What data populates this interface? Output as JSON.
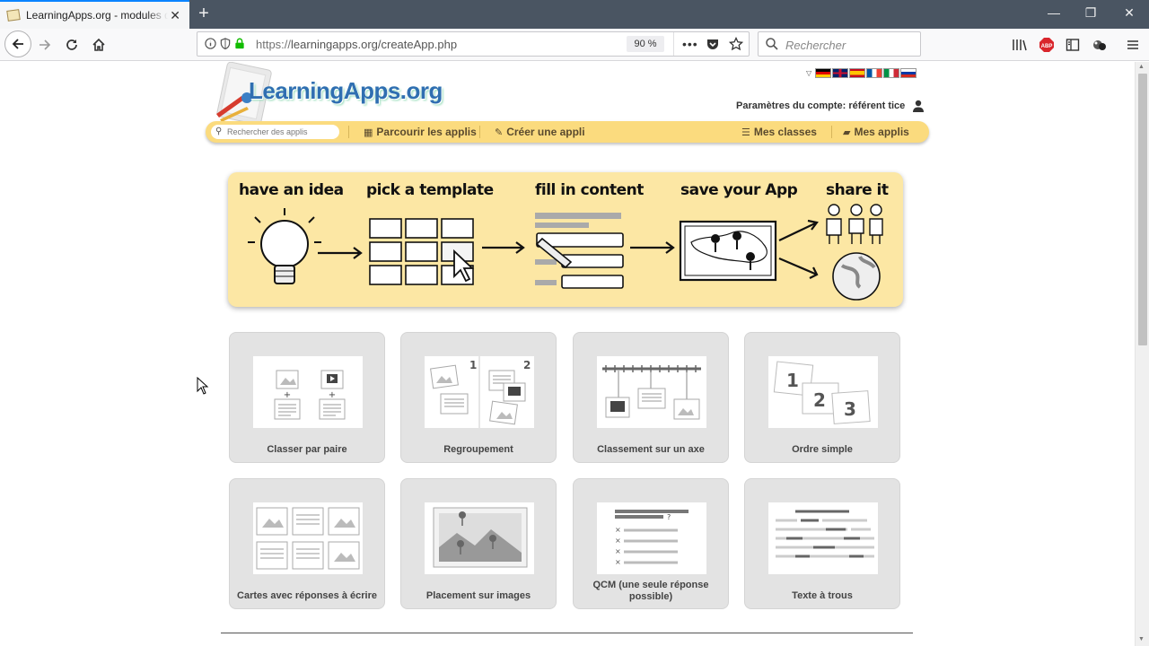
{
  "browser": {
    "tab_title": "LearningApps.org - modules d",
    "url_prefix": "https://",
    "url_main": "learningapps.org/createApp.php",
    "zoom": "90 %",
    "search_placeholder": "Rechercher",
    "window_controls": [
      "—",
      "❐",
      "✕"
    ],
    "tab_close": "✕",
    "new_tab": "+"
  },
  "site": {
    "logo": "LearningApps.org",
    "account_label": "Paramètres du compte: référent tice",
    "languages": [
      "de",
      "en",
      "es",
      "fr",
      "it",
      "ru"
    ],
    "nav": {
      "search_placeholder": "Rechercher des applis",
      "browse": "Parcourir les applis",
      "create": "Créer une appli",
      "classes": "Mes classes",
      "apps": "Mes applis"
    }
  },
  "banner": {
    "steps": [
      "have an idea",
      "pick a template",
      "fill in content",
      "save your App",
      "share it"
    ]
  },
  "templates": [
    {
      "label": "Classer par paire",
      "icon": "pair-matching-icon"
    },
    {
      "label": "Regroupement",
      "icon": "grouping-icon"
    },
    {
      "label": "Classement sur un axe",
      "icon": "timeline-icon"
    },
    {
      "label": "Ordre simple",
      "icon": "simple-order-icon"
    },
    {
      "label": "Cartes avec réponses à écrire",
      "icon": "written-answer-cards-icon"
    },
    {
      "label": "Placement sur images",
      "icon": "image-placement-icon"
    },
    {
      "label": "QCM (une seule réponse possible)",
      "icon": "single-choice-quiz-icon"
    },
    {
      "label": "Texte à trous",
      "icon": "fill-in-blanks-icon"
    }
  ],
  "colors": {
    "tabbar": "#4a5562",
    "menu_yellow": "#fbdb7e",
    "banner_yellow": "#fce7a4",
    "tile_gray": "#e3e3e3",
    "logo_blue": "#2f6fb1"
  }
}
